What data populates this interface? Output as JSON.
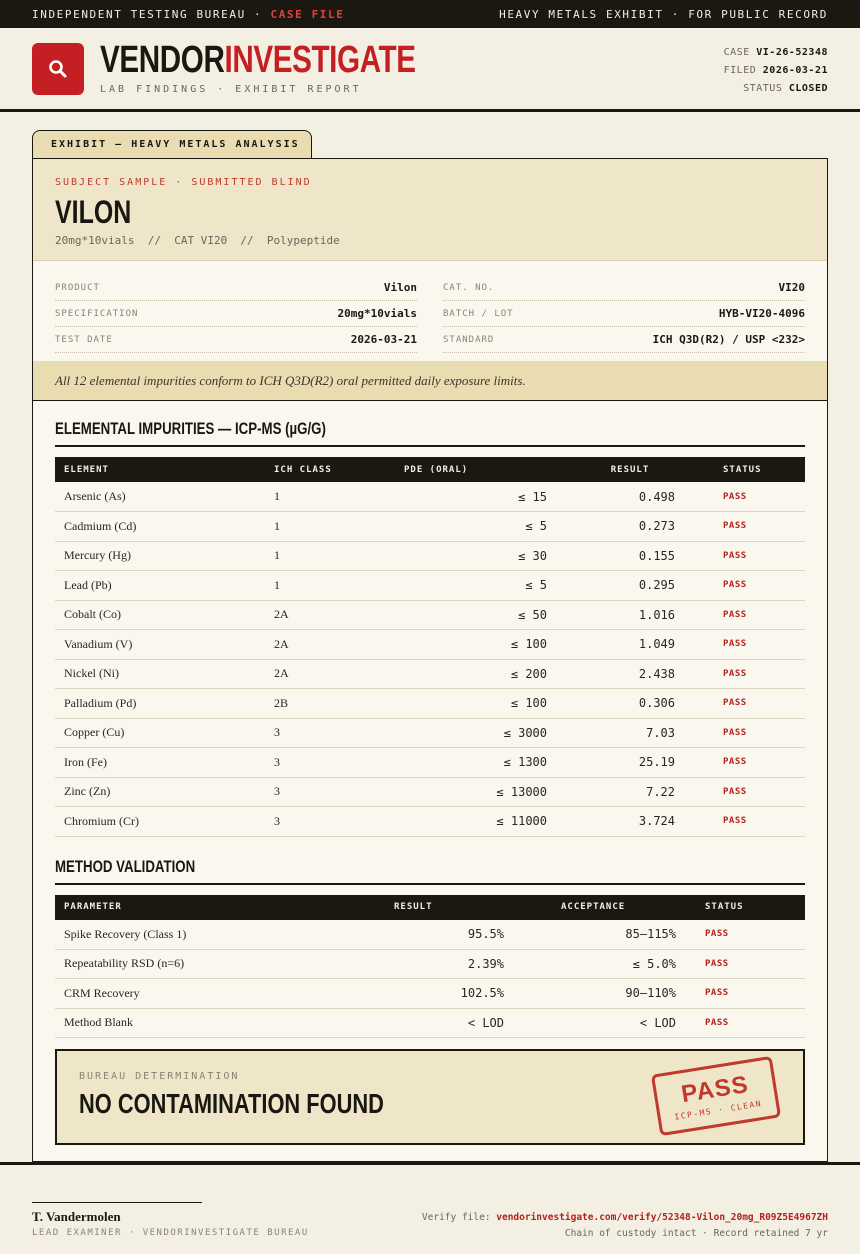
{
  "topbar": {
    "left_prefix": "INDEPENDENT TESTING BUREAU · ",
    "left_highlight": "CASE FILE",
    "right": "HEAVY METALS EXHIBIT · FOR PUBLIC RECORD"
  },
  "header": {
    "brand_part1": "VENDOR",
    "brand_part2": "INVESTIGATE",
    "subtitle": "LAB FINDINGS · EXHIBIT REPORT",
    "logo_icon": "magnifier-icon",
    "case_label": "CASE",
    "case_value": "VI-26-52348",
    "filed_label": "FILED",
    "filed_value": "2026-03-21",
    "status_label": "STATUS",
    "status_value": "CLOSED"
  },
  "exhibit": {
    "tab_label": "EXHIBIT — HEAVY METALS ANALYSIS",
    "subject_label": "SUBJECT SAMPLE · SUBMITTED BLIND",
    "subject_name": "VILON",
    "subject_desc": "20mg*10vials  //  CAT VI20  //  Polypeptide"
  },
  "meta": {
    "left": [
      {
        "k": "PRODUCT",
        "v": "Vilon"
      },
      {
        "k": "SPECIFICATION",
        "v": "20mg*10vials"
      },
      {
        "k": "TEST DATE",
        "v": "2026-03-21"
      }
    ],
    "right": [
      {
        "k": "CAT. NO.",
        "v": "VI20"
      },
      {
        "k": "BATCH / LOT",
        "v": "HYB-VI20-4096"
      },
      {
        "k": "STANDARD",
        "v": "ICH Q3D(R2) / USP <232>"
      }
    ]
  },
  "conform_note": "All 12 elemental impurities conform to ICH Q3D(R2) oral permitted daily exposure limits.",
  "impurities": {
    "title": "ELEMENTAL IMPURITIES — ICP-MS (µG/G)",
    "headers": [
      "ELEMENT",
      "ICH CLASS",
      "PDE (ORAL)",
      "RESULT",
      "STATUS"
    ],
    "rows": [
      [
        "Arsenic (As)",
        "1",
        "≤ 15",
        "0.498",
        "PASS"
      ],
      [
        "Cadmium (Cd)",
        "1",
        "≤ 5",
        "0.273",
        "PASS"
      ],
      [
        "Mercury (Hg)",
        "1",
        "≤ 30",
        "0.155",
        "PASS"
      ],
      [
        "Lead (Pb)",
        "1",
        "≤ 5",
        "0.295",
        "PASS"
      ],
      [
        "Cobalt (Co)",
        "2A",
        "≤ 50",
        "1.016",
        "PASS"
      ],
      [
        "Vanadium (V)",
        "2A",
        "≤ 100",
        "1.049",
        "PASS"
      ],
      [
        "Nickel (Ni)",
        "2A",
        "≤ 200",
        "2.438",
        "PASS"
      ],
      [
        "Palladium (Pd)",
        "2B",
        "≤ 100",
        "0.306",
        "PASS"
      ],
      [
        "Copper (Cu)",
        "3",
        "≤ 3000",
        "7.03",
        "PASS"
      ],
      [
        "Iron (Fe)",
        "3",
        "≤ 1300",
        "25.19",
        "PASS"
      ],
      [
        "Zinc (Zn)",
        "3",
        "≤ 13000",
        "7.22",
        "PASS"
      ],
      [
        "Chromium (Cr)",
        "3",
        "≤ 11000",
        "3.724",
        "PASS"
      ]
    ]
  },
  "validation": {
    "title": "METHOD VALIDATION",
    "headers": [
      "PARAMETER",
      "RESULT",
      "ACCEPTANCE",
      "STATUS"
    ],
    "rows": [
      [
        "Spike Recovery (Class 1)",
        "95.5%",
        "85–115%",
        "PASS"
      ],
      [
        "Repeatability RSD (n=6)",
        "2.39%",
        "≤ 5.0%",
        "PASS"
      ],
      [
        "CRM Recovery",
        "102.5%",
        "90–110%",
        "PASS"
      ],
      [
        "Method Blank",
        "< LOD",
        "< LOD",
        "PASS"
      ]
    ]
  },
  "determination": {
    "label": "BUREAU DETERMINATION",
    "text": "NO CONTAMINATION FOUND",
    "stamp_main": "PASS",
    "stamp_sub": "ICP-MS · CLEAN"
  },
  "footer": {
    "signer_name": "T. Vandermolen",
    "signer_role": "LEAD EXAMINER · VENDORINVESTIGATE BUREAU",
    "verify_label": "Verify file: ",
    "verify_url": "vendorinvestigate.com/verify/52348-Vilon_20mg_R09Z5E4967ZH",
    "custody": "Chain of custody intact · Record retained 7 yr"
  },
  "colors": {
    "accent_red": "#c41f23",
    "ink": "#1b1812",
    "paper": "#f4efe3",
    "tan": "#e9dcb0"
  }
}
